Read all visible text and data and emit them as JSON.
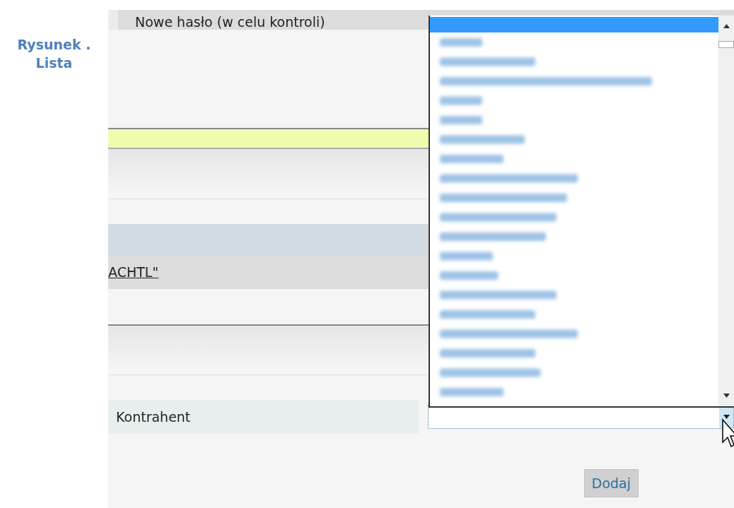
{
  "caption": "Rysunek . Lista",
  "header": "Nowe hasło (w celu kontroli)",
  "link": "ACHTL\"",
  "field": {
    "label": "Kontrahent"
  },
  "dropdown": {
    "expanded": true
  },
  "button": "Dodaj"
}
